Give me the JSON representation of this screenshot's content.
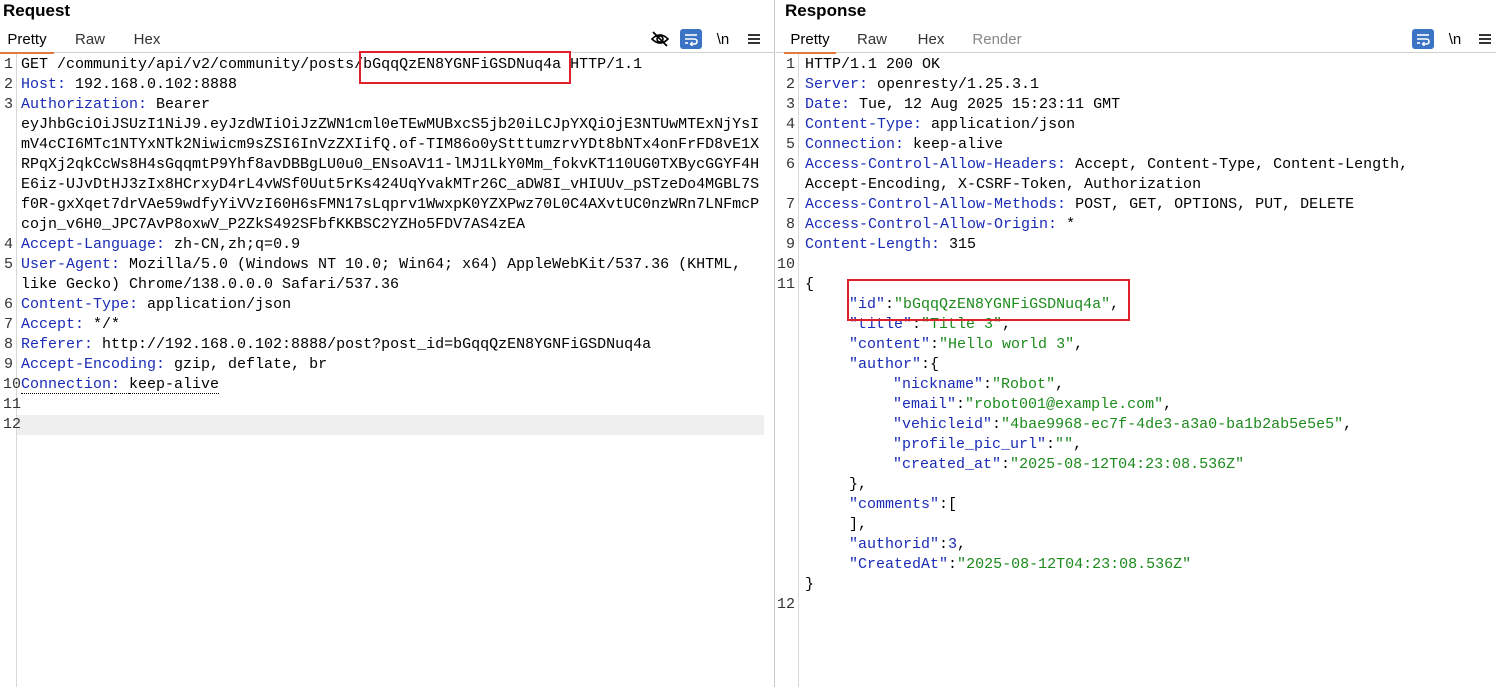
{
  "request": {
    "title": "Request",
    "tabs": [
      "Pretty",
      "Raw",
      "Hex"
    ],
    "active_tab": "Pretty",
    "icons": [
      "eye-slash-icon",
      "wrap-icon",
      "newline-icon",
      "menu-icon"
    ],
    "newline_label": "\\n",
    "line_numbers": [
      "1",
      "2",
      "3",
      "4",
      "5",
      "6",
      "7",
      "8",
      "9",
      "10",
      "11",
      "12"
    ],
    "request_line": {
      "method": "GET",
      "path": "/community/api/v2/community/posts/",
      "post_id": "bGqqQzEN8YGNFiGSDNuq4a",
      "version": "HTTP/1.1"
    },
    "headers": [
      {
        "key": "Host",
        "value": "192.168.0.102:8888"
      },
      {
        "key": "Authorization",
        "value": "Bearer"
      },
      {
        "key": "Accept-Language",
        "value": "zh-CN,zh;q=0.9"
      },
      {
        "key": "User-Agent",
        "value": "Mozilla/5.0 (Windows NT 10.0; Win64; x64) AppleWebKit/537.36 (KHTML,"
      },
      {
        "key": "Content-Type",
        "value": "application/json"
      },
      {
        "key": "Accept",
        "value": "*/*"
      },
      {
        "key": "Referer",
        "value": "http://192.168.0.102:8888/post?post_id=bGqqQzEN8YGNFiGSDNuq4a"
      },
      {
        "key": "Accept-Encoding",
        "value": "gzip, deflate, br"
      },
      {
        "key": "Connection",
        "value": "keep-alive"
      }
    ],
    "token_lines": [
      "eyJhbGciOiJSUzI1NiJ9.eyJzdWIiOiJzZWN1cml0eTEwMUBxcS5jb20iLCJpYXQiOjE3NTUwMTExNjYsI",
      "mV4cCI6MTc1NTYxNTk2Niwicm9sZSI6InVzZXIifQ.of-TIM86o0yStttumzrvYDt8bNTx4onFrFD8vE1X",
      "RPqXj2qkCcWs8H4sGqqmtP9Yhf8avDBBgLU0u0_ENsoAV11-lMJ1LkY0Mm_fokvKT110UG0TXBycGGYF4H",
      "E6iz-UJvDtHJ3zIx8HCrxyD4rL4vWSf0Uut5rKs424UqYvakMTr26C_aDW8I_vHIUUv_pSTzeDo4MGBL7S",
      "f0R-gxXqet7drVAe59wdfyYiVVzI60H6sFMN17sLqprv1WwxpK0YZXPwz70L0C4AXvtUC0nzWRn7LNFmcP",
      "cojn_v6H0_JPC7AvP8oxwV_P2ZkS492SFbfKKBSC2YZHo5FDV7AS4zEA"
    ],
    "ua_continuation": "like Gecko) Chrome/138.0.0.0 Safari/537.36"
  },
  "response": {
    "title": "Response",
    "tabs": [
      "Pretty",
      "Raw",
      "Hex",
      "Render"
    ],
    "active_tab": "Pretty",
    "icons": [
      "wrap-icon",
      "newline-icon",
      "menu-icon"
    ],
    "newline_label": "\\n",
    "line_numbers": [
      "1",
      "2",
      "3",
      "4",
      "5",
      "6",
      "7",
      "8",
      "9",
      "10",
      "11",
      "12"
    ],
    "status_line": "HTTP/1.1 200 OK",
    "headers": [
      {
        "key": "Server",
        "value": "openresty/1.25.3.1"
      },
      {
        "key": "Date",
        "value": "Tue, 12 Aug 2025 15:23:11 GMT"
      },
      {
        "key": "Content-Type",
        "value": "application/json"
      },
      {
        "key": "Connection",
        "value": "keep-alive"
      },
      {
        "key": "Access-Control-Allow-Headers",
        "value": "Accept, Content-Type, Content-Length,"
      },
      {
        "key": "Access-Control-Allow-Methods",
        "value": "POST, GET, OPTIONS, PUT, DELETE"
      },
      {
        "key": "Access-Control-Allow-Origin",
        "value": "*"
      },
      {
        "key": "Content-Length",
        "value": "315"
      }
    ],
    "allow_headers_continuation": "Accept-Encoding, X-CSRF-Token, Authorization",
    "body": {
      "id": "bGqqQzEN8YGNFiGSDNuq4a",
      "title": "Title 3",
      "content": "Hello world 3",
      "author": {
        "nickname": "Robot",
        "email": "robot001@example.com",
        "vehicleid": "4bae9968-ec7f-4de3-a3a0-ba1b2ab5e5e5",
        "profile_pic_url": "",
        "created_at": "2025-08-12T04:23:08.536Z"
      },
      "authorid": "3",
      "CreatedAt": "2025-08-12T04:23:08.536Z"
    }
  },
  "colors": {
    "header_key": "#1a2bb5",
    "json_string": "#1d8a1d",
    "highlight_box": "#e0202a",
    "active_tab_underline": "#e07b39",
    "wrap_button": "#3b74c4"
  }
}
